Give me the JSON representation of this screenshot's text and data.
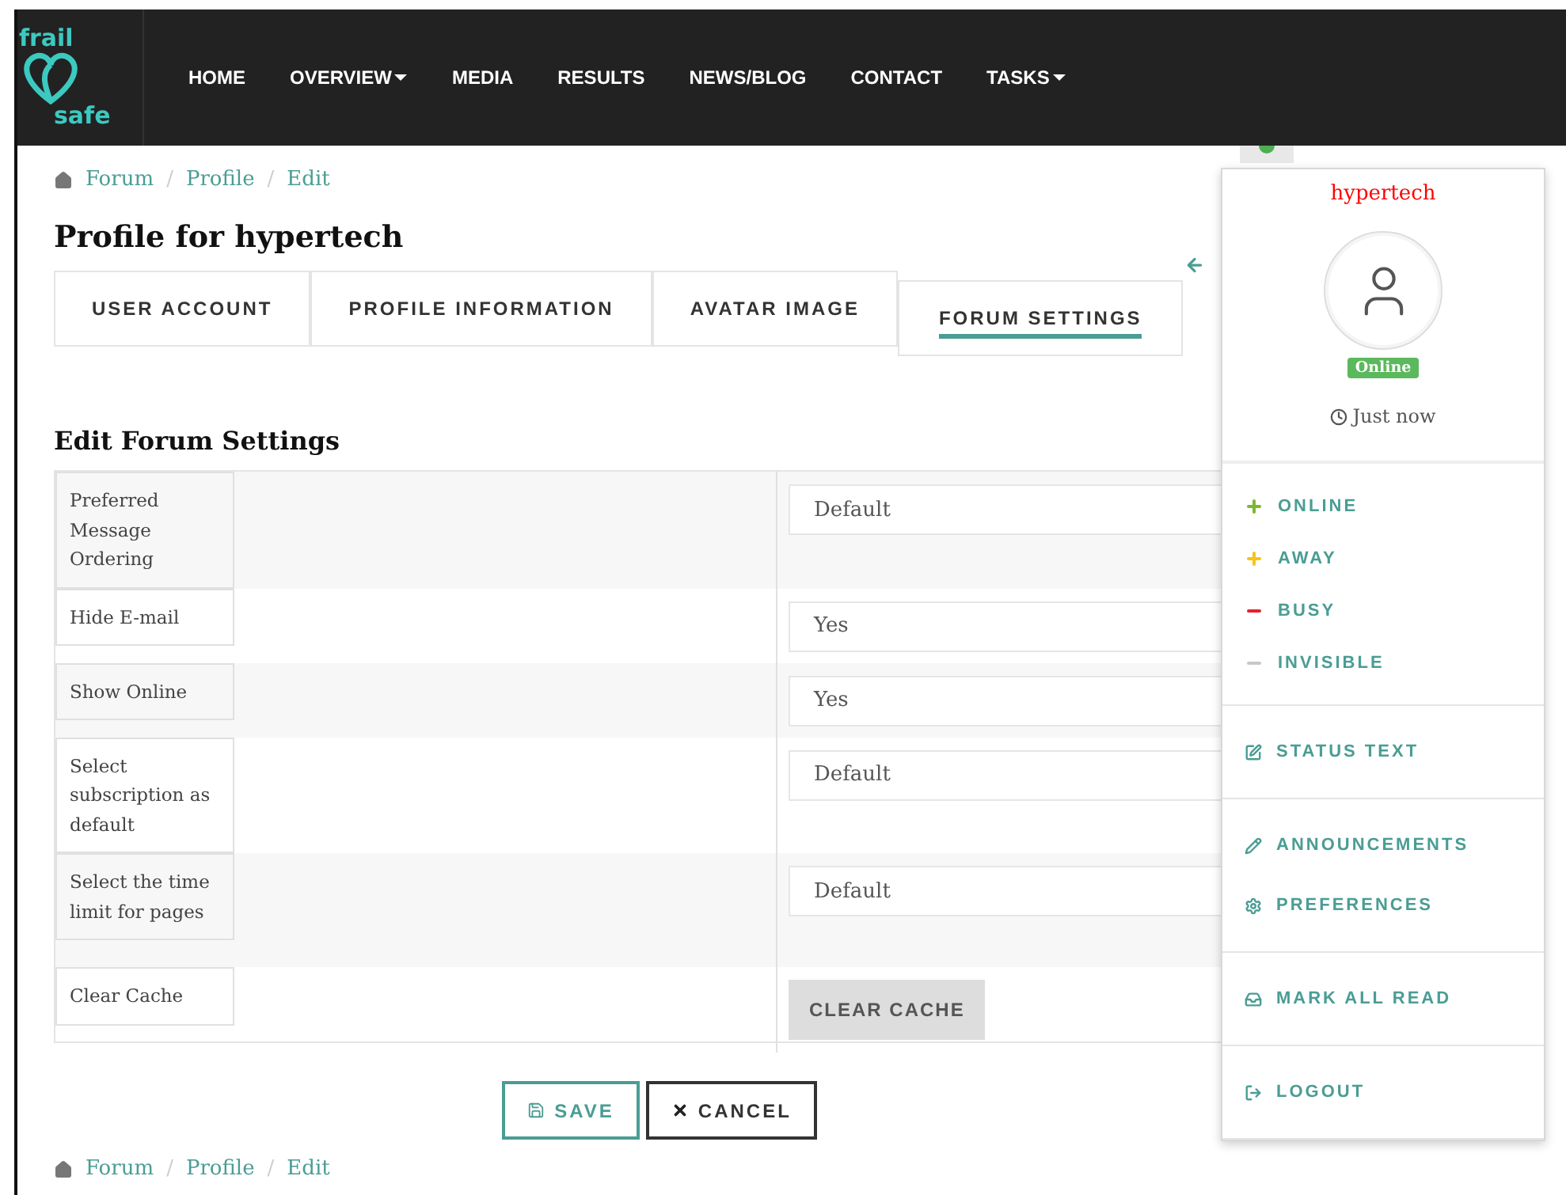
{
  "logo": {
    "top": "frail",
    "bottom": "safe"
  },
  "nav": [
    {
      "label": "HOME",
      "has_menu": false
    },
    {
      "label": "OVERVIEW",
      "has_menu": true
    },
    {
      "label": "MEDIA",
      "has_menu": false
    },
    {
      "label": "RESULTS",
      "has_menu": false
    },
    {
      "label": "NEWS/BLOG",
      "has_menu": false
    },
    {
      "label": "CONTACT",
      "has_menu": false
    },
    {
      "label": "TASKS",
      "has_menu": true
    }
  ],
  "breadcrumb": [
    {
      "label": "Forum"
    },
    {
      "separator": "/",
      "label": "Profile"
    },
    {
      "separator": "/",
      "label": "Edit"
    }
  ],
  "title": "Profile for hypertech",
  "tabs": [
    {
      "label": "USER ACCOUNT",
      "selected": false
    },
    {
      "label": "PROFILE INFORMATION",
      "selected": false
    },
    {
      "label": "AVATAR IMAGE",
      "selected": false
    },
    {
      "label": "FORUM SETTINGS",
      "selected": true
    }
  ],
  "section_heading": "Edit Forum Settings",
  "settings": [
    {
      "label": "Preferred Message Ordering",
      "kind": "select",
      "value": "Default"
    },
    {
      "label": "Hide E-mail",
      "kind": "select",
      "value": "Yes"
    },
    {
      "label": "Show Online",
      "kind": "select",
      "value": "Yes"
    },
    {
      "label": "Select subscription as default",
      "kind": "select",
      "value": "Default"
    },
    {
      "label": "Select the time limit for pages",
      "kind": "select",
      "value": "Default"
    },
    {
      "label": "Clear Cache",
      "kind": "button",
      "value": "CLEAR CACHE"
    }
  ],
  "buttons": [
    {
      "label": "SAVE",
      "kind": "save"
    },
    {
      "label": "CANCEL",
      "kind": "cancel"
    }
  ],
  "breadcrumb_bottom": [
    {
      "label": "Forum"
    },
    {
      "separator": "/",
      "label": "Profile"
    },
    {
      "separator": "/",
      "label": "Edit"
    }
  ],
  "user_menu": {
    "username": "hypertech",
    "presence": "Online",
    "last_seen": "Just now",
    "statuses": [
      {
        "label": "ONLINE",
        "kind": "plus",
        "color": "#7cb82f"
      },
      {
        "label": "AWAY",
        "kind": "plus",
        "color": "#f5c518"
      },
      {
        "label": "BUSY",
        "kind": "minus",
        "color": "#e8202a"
      },
      {
        "label": "INVISIBLE",
        "kind": "minus",
        "color": "#c8c8c8"
      }
    ],
    "groups": [
      [
        {
          "label": "STATUS TEXT",
          "kind": "edit"
        }
      ],
      [
        {
          "label": "ANNOUNCEMENTS",
          "kind": "pencil"
        },
        {
          "label": "PREFERENCES",
          "kind": "gear"
        }
      ],
      [
        {
          "label": "MARK ALL READ",
          "kind": "inbox"
        }
      ],
      [
        {
          "label": "LOGOUT",
          "kind": "logout"
        }
      ]
    ]
  }
}
